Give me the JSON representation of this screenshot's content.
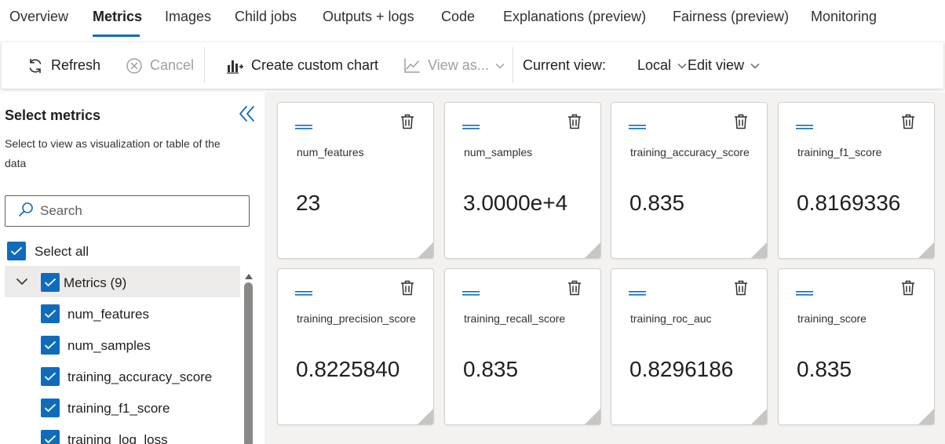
{
  "tabs": [
    {
      "label": "Overview"
    },
    {
      "label": "Metrics"
    },
    {
      "label": "Images"
    },
    {
      "label": "Child jobs"
    },
    {
      "label": "Outputs + logs"
    },
    {
      "label": "Code"
    },
    {
      "label": "Explanations (preview)"
    },
    {
      "label": "Fairness (preview)"
    },
    {
      "label": "Monitoring"
    }
  ],
  "active_tab": "Metrics",
  "toolbar": {
    "refresh": "Refresh",
    "cancel": "Cancel",
    "create_chart": "Create custom chart",
    "view_as": "View as...",
    "current_view_label": "Current view:",
    "current_view_value": "Local",
    "edit_view": "Edit view"
  },
  "sidebar": {
    "title": "Select metrics",
    "description": "Select to view as visualization or table of the data",
    "search_placeholder": "Search",
    "select_all": "Select all",
    "group_label": "Metrics (9)",
    "items": [
      {
        "label": "num_features"
      },
      {
        "label": "num_samples"
      },
      {
        "label": "training_accuracy_score"
      },
      {
        "label": "training_f1_score"
      },
      {
        "label": "training_log_loss"
      }
    ]
  },
  "cards": [
    {
      "name": "num_features",
      "value": "23"
    },
    {
      "name": "num_samples",
      "value": "3.0000e+4"
    },
    {
      "name": "training_accuracy_score",
      "value": "0.835"
    },
    {
      "name": "training_f1_score",
      "value": "0.8169336"
    },
    {
      "name": "training_precision_score",
      "value": "0.8225840"
    },
    {
      "name": "training_recall_score",
      "value": "0.835"
    },
    {
      "name": "training_roc_auc",
      "value": "0.8296186"
    },
    {
      "name": "training_score",
      "value": "0.835"
    }
  ],
  "colors": {
    "accent": "#0f6cbd",
    "drag_handle": "#0f6cbd",
    "disabled_text": "#a19f9d"
  },
  "icons": {
    "refresh": "refresh-icon",
    "cancel": "cancel-icon",
    "create_chart": "bar-chart-add-icon",
    "view_as": "line-chart-icon",
    "collapse": "double-chevron-left-icon",
    "search": "search-icon",
    "trash": "trash-icon",
    "drag": "drag-handle-icon"
  }
}
